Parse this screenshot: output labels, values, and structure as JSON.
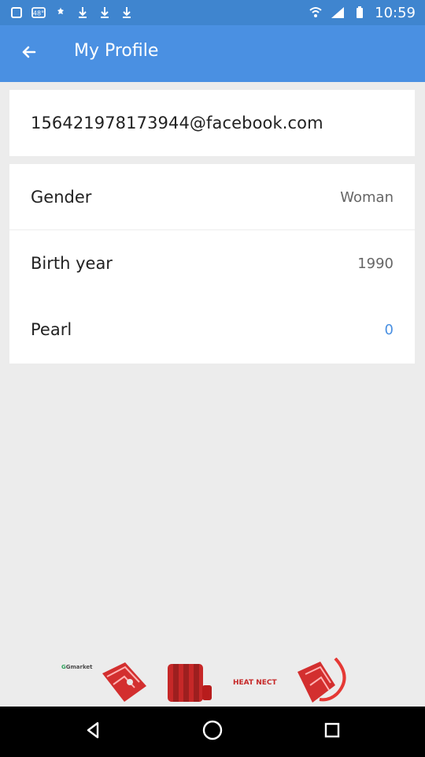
{
  "status_bar": {
    "time": "10:59",
    "battery_icon": "battery-icon",
    "wifi_icon": "wifi-icon",
    "signal_icon": "signal-icon",
    "left_icons": [
      "notification-icon",
      "badge-48-icon",
      "settings-icon",
      "download-icon",
      "download-icon",
      "download-icon"
    ]
  },
  "app_bar": {
    "title": "My Profile",
    "back_icon": "arrow-back-icon"
  },
  "profile": {
    "email": "156421978173944@facebook.com",
    "rows": [
      {
        "label": "Gender",
        "value": "Woman"
      },
      {
        "label": "Birth year",
        "value": "1990"
      },
      {
        "label": "Pearl",
        "value": "0"
      }
    ]
  },
  "ad_banner": {
    "logo": "Gmarket",
    "product_text": "HEAT NECT"
  },
  "nav_bar": {
    "back": "nav-back-icon",
    "home": "nav-home-icon",
    "recent": "nav-recent-apps-icon"
  },
  "colors": {
    "primary": "#4a90e2",
    "status_bar": "#3f85cf",
    "background": "#ececec",
    "text": "#222222",
    "muted": "#666666"
  }
}
